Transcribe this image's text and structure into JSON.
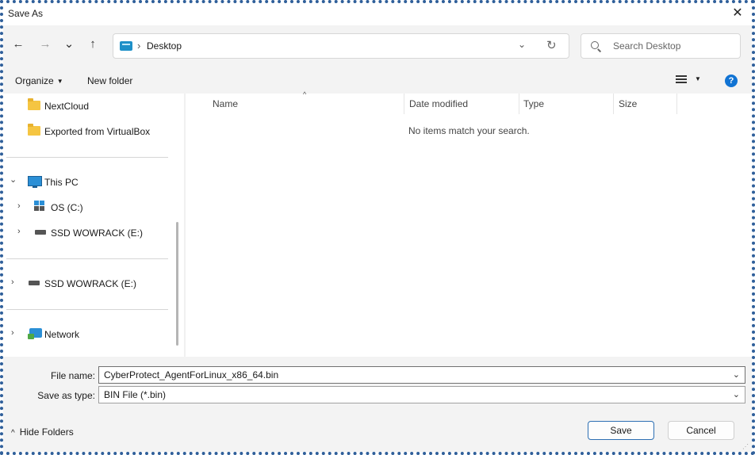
{
  "window": {
    "title": "Save As",
    "close_glyph": "✕"
  },
  "nav": {
    "back": "←",
    "forward": "→",
    "recent": "⌄",
    "up": "↑"
  },
  "address": {
    "separator": "›",
    "location": "Desktop",
    "dropdown": "⌄",
    "refresh": "↻"
  },
  "search": {
    "placeholder": "Search Desktop"
  },
  "toolbar": {
    "organize": "Organize",
    "new_folder": "New folder",
    "help": "?"
  },
  "sidebar": {
    "items": [
      {
        "label": "NextCloud"
      },
      {
        "label": "Exported from VirtualBox"
      },
      {
        "label": "This PC"
      },
      {
        "label": "OS (C:)"
      },
      {
        "label": "SSD WOWRACK (E:)"
      },
      {
        "label": "SSD WOWRACK (E:)"
      },
      {
        "label": "Network"
      }
    ],
    "chev_right": "›",
    "chev_down": "⌄"
  },
  "columns": {
    "name": "Name",
    "date_modified": "Date modified",
    "type": "Type",
    "size": "Size",
    "sort": "^"
  },
  "main": {
    "empty_message": "No items match your search."
  },
  "form": {
    "file_name_label": "File name:",
    "file_name_value": "CyberProtect_AgentForLinux_x86_64.bin",
    "save_type_label": "Save as type:",
    "save_type_value": "BIN File (*.bin)",
    "dropdown": "⌄"
  },
  "footer": {
    "hide_folders": "Hide Folders",
    "up_glyph": "^",
    "save": "Save",
    "cancel": "Cancel",
    "grip": "⋰"
  }
}
